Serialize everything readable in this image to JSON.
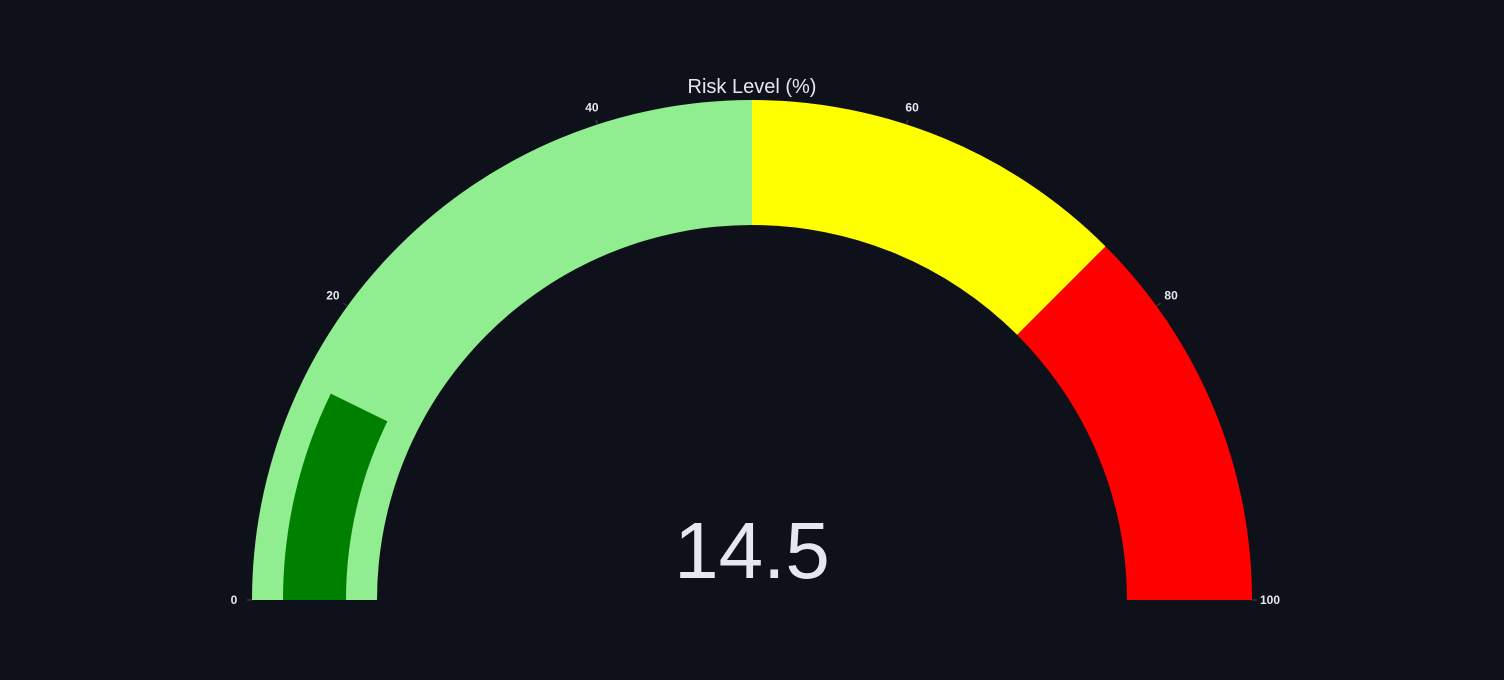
{
  "chart_data": {
    "type": "gauge",
    "title": "Risk Level (%)",
    "value": 14.5,
    "value_display": "14.5",
    "range": [
      0,
      100
    ],
    "ticks": [
      0,
      20,
      40,
      60,
      80,
      100
    ],
    "tick_labels": [
      "0",
      "20",
      "40",
      "60",
      "80",
      "100"
    ],
    "steps": [
      {
        "range": [
          0,
          50
        ],
        "color": "#90ee90"
      },
      {
        "range": [
          50,
          75
        ],
        "color": "#ffff00"
      },
      {
        "range": [
          75,
          100
        ],
        "color": "#ff0000"
      }
    ],
    "bar_color": "#008000",
    "background": "#0f111a",
    "text_color": "#e6e8ef"
  }
}
